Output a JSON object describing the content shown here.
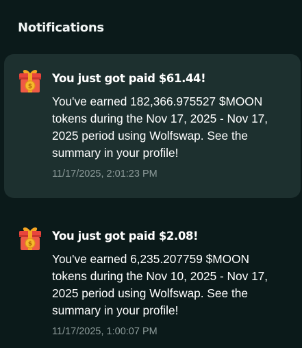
{
  "header": {
    "title": "Notifications"
  },
  "notifications": [
    {
      "icon": "gift-coin-icon",
      "title": "You just got paid $61.44!",
      "body": "You've earned 182,366.975527 $MOON tokens during the Nov 17, 2025 - Nov 17, 2025 period using Wolfswap. See the summary in your profile!",
      "timestamp": "11/17/2025, 2:01:23 PM",
      "highlighted": true
    },
    {
      "icon": "gift-coin-icon",
      "title": "You just got paid $2.08!",
      "body": "You've earned 6,235.207759 $MOON tokens during the Nov 10, 2025 - Nov 17, 2025 period using Wolfswap. See the summary in your profile!",
      "timestamp": "11/17/2025, 1:00:07 PM",
      "highlighted": false
    }
  ],
  "colors": {
    "background": "#0b1a1a",
    "card_highlight": "#1d302f",
    "timestamp": "#8c9a99",
    "gift_red": "#e8453c",
    "gift_ribbon": "#f5a623",
    "coin": "#f6b92b"
  }
}
